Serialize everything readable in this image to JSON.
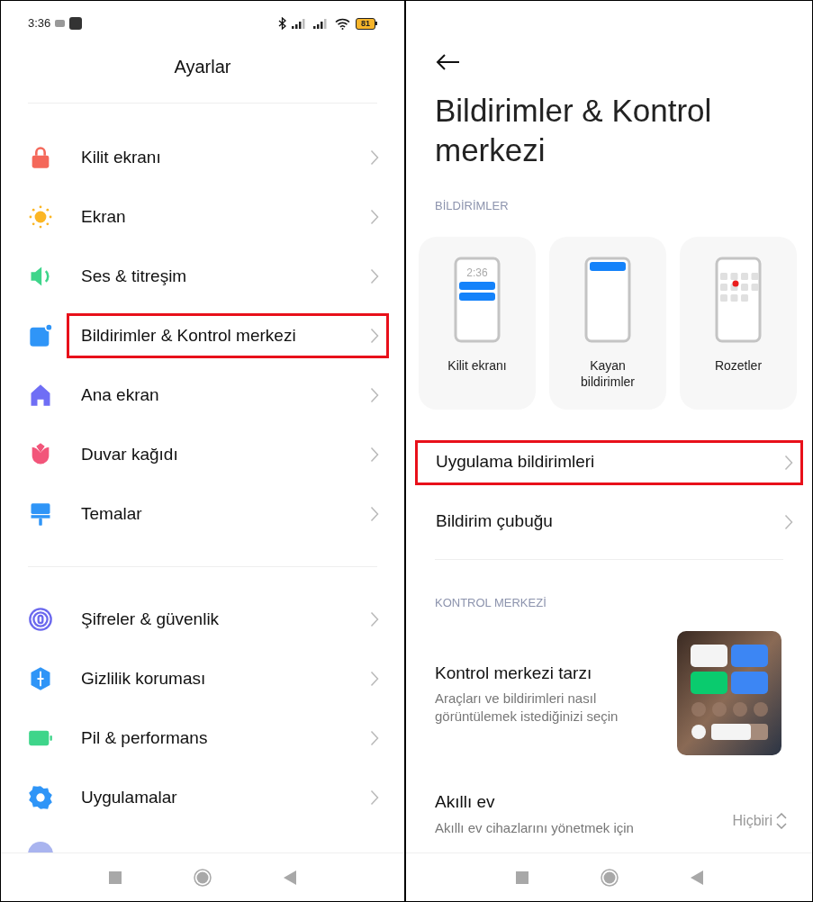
{
  "status_bar": {
    "time": "3:36",
    "battery": "81"
  },
  "left": {
    "title": "Ayarlar",
    "groups": [
      [
        {
          "label": "Kilit ekranı",
          "highlighted": false
        },
        {
          "label": "Ekran",
          "highlighted": false
        },
        {
          "label": "Ses & titreşim",
          "highlighted": false
        },
        {
          "label": "Bildirimler & Kontrol merkezi",
          "highlighted": true
        },
        {
          "label": "Ana ekran",
          "highlighted": false
        },
        {
          "label": "Duvar kağıdı",
          "highlighted": false
        },
        {
          "label": "Temalar",
          "highlighted": false
        }
      ],
      [
        {
          "label": "Şifreler & güvenlik",
          "highlighted": false
        },
        {
          "label": "Gizlilik koruması",
          "highlighted": false
        },
        {
          "label": "Pil & performans",
          "highlighted": false
        },
        {
          "label": "Uygulamalar",
          "highlighted": false
        }
      ]
    ]
  },
  "right": {
    "title": "Bildirimler & Kontrol merkezi",
    "notifications_header": "BİLDİRİMLER",
    "styles": [
      {
        "kind": "lock",
        "label": "Kilit ekranı",
        "time": "2:36"
      },
      {
        "kind": "floating",
        "label": "Kayan bildirimler"
      },
      {
        "kind": "badges",
        "label": "Rozetler"
      }
    ],
    "rows": [
      {
        "label": "Uygulama bildirimleri",
        "highlighted": true
      },
      {
        "label": "Bildirim çubuğu",
        "highlighted": false
      }
    ],
    "control_header": "KONTROL MERKEZİ",
    "control_style": {
      "title": "Kontrol merkezi tarzı",
      "subtitle": "Araçları ve bildirimleri nasıl görüntülemek istediğinizi seçin"
    },
    "smart_home": {
      "title": "Akıllı ev",
      "subtitle": "Akıllı ev cihazlarını yönetmek için",
      "value": "Hiçbiri"
    }
  }
}
